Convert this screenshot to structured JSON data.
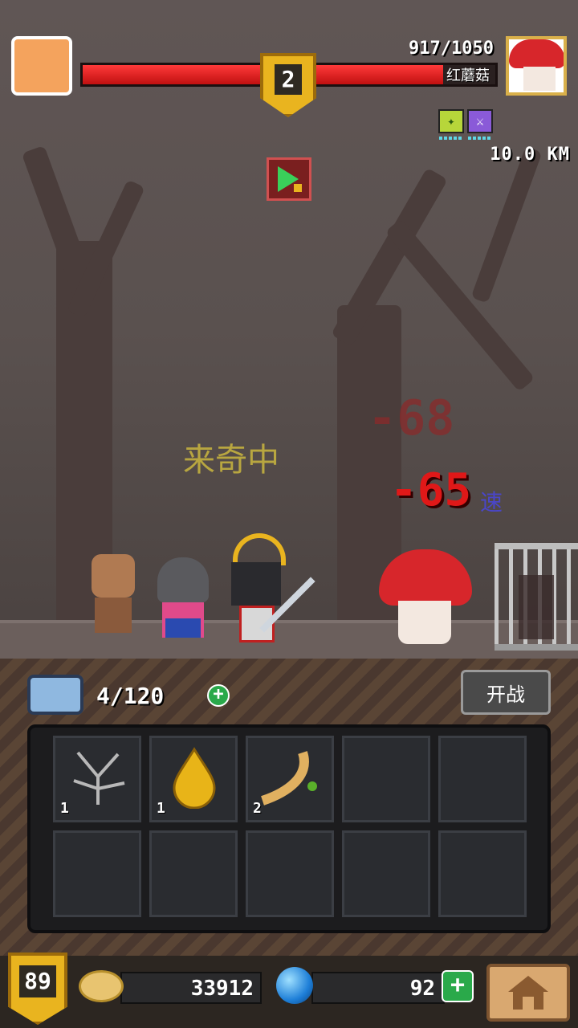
{
  "boss": {
    "hp_text": "917/1050",
    "name": "红蘑菇",
    "hp_fraction": 0.873
  },
  "stage": {
    "level": "2"
  },
  "hud": {
    "distance": "10.0 KM"
  },
  "float": {
    "dmg1": "-68",
    "dmg2": "-65",
    "speed_tag": "速",
    "status": "来奇中"
  },
  "bag": {
    "count": "4/120",
    "fight_label": "开战"
  },
  "inventory": {
    "slots": [
      {
        "name": "branch-item",
        "count": "1"
      },
      {
        "name": "oil-drop-item",
        "count": "1"
      },
      {
        "name": "root-item",
        "count": "2"
      },
      {
        "name": "empty",
        "count": ""
      },
      {
        "name": "empty",
        "count": ""
      },
      {
        "name": "empty",
        "count": ""
      },
      {
        "name": "empty",
        "count": ""
      },
      {
        "name": "empty",
        "count": ""
      },
      {
        "name": "empty",
        "count": ""
      },
      {
        "name": "empty",
        "count": ""
      }
    ]
  },
  "player": {
    "level": "89",
    "coins": "33912",
    "gems": "92"
  },
  "colors": {
    "hp": "#e02020",
    "gold": "#e9b41f",
    "gem": "#1e7fd8",
    "plus": "#2aa94a"
  }
}
